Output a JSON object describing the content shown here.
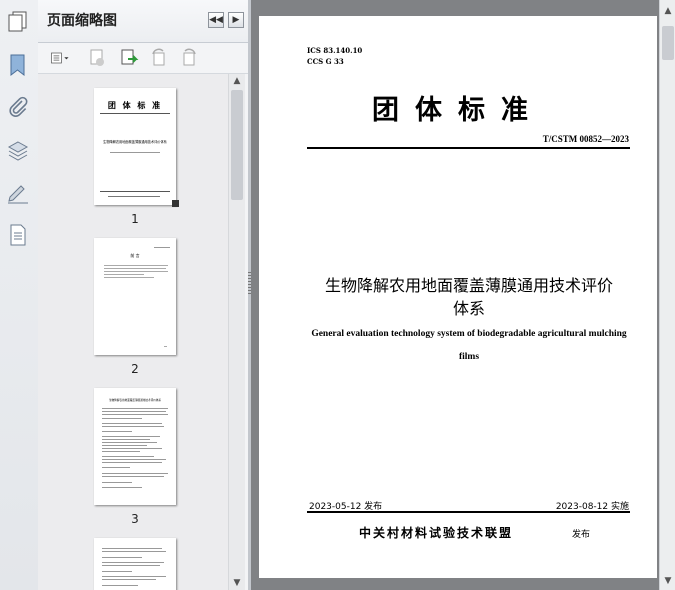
{
  "panel": {
    "title": "页面缩略图",
    "thumbnails": [
      {
        "number": "1",
        "mini_title": "团 体 标 准",
        "mini_heading": "生物降解农用地面覆盖薄膜通用技术评价体系"
      },
      {
        "number": "2",
        "mini_title": "前 言"
      },
      {
        "number": "3",
        "mini_title": "生物降解农用地面覆盖薄膜通用技术评价体系"
      }
    ]
  },
  "document": {
    "ics": "ICS 83.140.10",
    "ccs": "CCS G 33",
    "title": "团体标准",
    "code": "T/CSTM 00852—2023",
    "cn_title_line1": "生物降解农用地面覆盖薄膜通用技术评价",
    "cn_title_line2": "体系",
    "en_title_line1": "General evaluation technology system of biodegradable agricultural mulching",
    "en_title_line2": "films",
    "publish_date": "2023-05-12 发布",
    "implement_date": "2023-08-12  实施",
    "organization": "中关村材料试验技术联盟",
    "org_release": "发布"
  },
  "colors": {
    "viewer_bg": "#808285",
    "panel_bg": "#f3f4f6",
    "rail_icon": "#5b7fa8"
  }
}
